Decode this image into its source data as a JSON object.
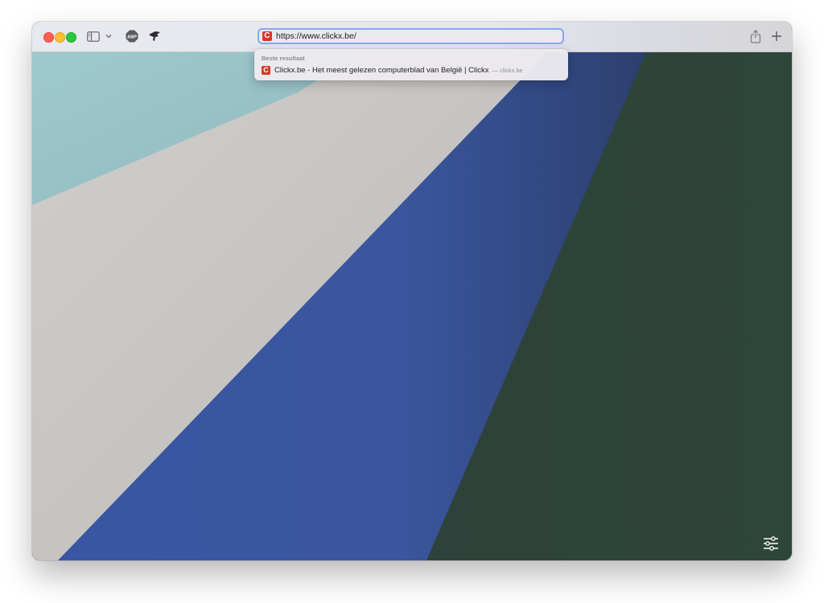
{
  "toolbar": {
    "address_url": "https://www.clickx.be/",
    "favicon_letter": "C",
    "icons": {
      "sidebar": "sidebar-icon",
      "chevron": "chevron-down-icon",
      "adblock": "adblock-plus-icon",
      "extension": "bird-extension-icon",
      "share": "share-icon",
      "new_tab": "plus-icon"
    }
  },
  "suggestions": {
    "heading": "Beste resultaat",
    "items": [
      {
        "favicon_letter": "C",
        "title": "Clickx.be - Het meest gelezen computerblad van België | Clickx",
        "domain": "— clickx.be"
      }
    ]
  },
  "content": {
    "settings_icon": "sliders-icon"
  },
  "colors": {
    "accent_focus": "#8aa7ef",
    "favicon": "#d23a26",
    "wallpaper_teal": "#9bc7cc",
    "wallpaper_gray": "#c7c5c3",
    "wallpaper_blue": "#3b55a0",
    "wallpaper_green": "#2e4438"
  }
}
